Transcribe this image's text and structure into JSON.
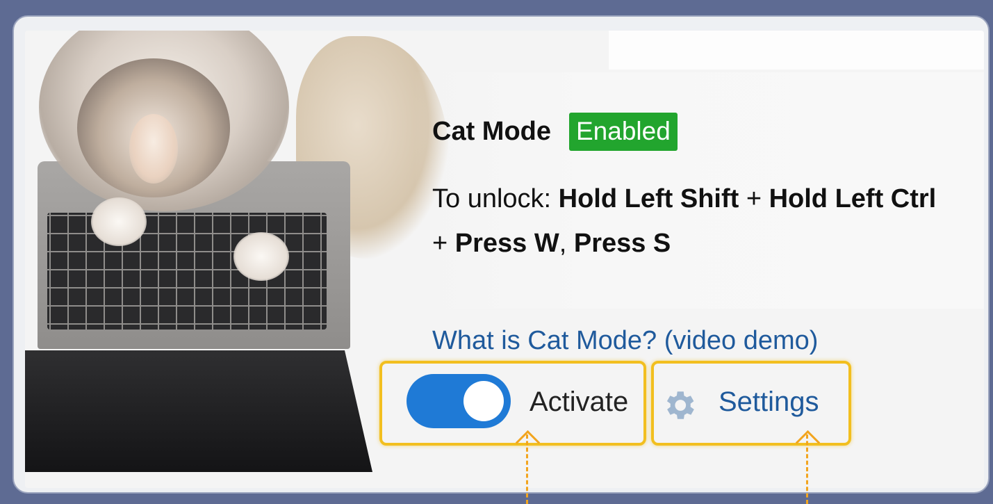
{
  "cat_mode": {
    "title": "Cat Mode",
    "status_badge": "Enabled",
    "unlock_prefix": "To unlock: ",
    "unlock_keys": {
      "k1": "Hold Left Shift",
      "plus1": " + ",
      "k2": "Hold Left Ctrl",
      "plus2": " + ",
      "k3": "Press W",
      "comma": ", ",
      "k4": "Press S"
    },
    "help_link": "What is Cat Mode? (video demo)",
    "activate_label": "Activate",
    "activate_on": true,
    "settings_label": "Settings"
  },
  "icons": {
    "settings": "gear-icon"
  },
  "colors": {
    "badge": "#22a52e",
    "toggle": "#1f7ad6",
    "link": "#1f5a9c",
    "highlight": "#f2bf1f",
    "background": "#5e6b93"
  }
}
